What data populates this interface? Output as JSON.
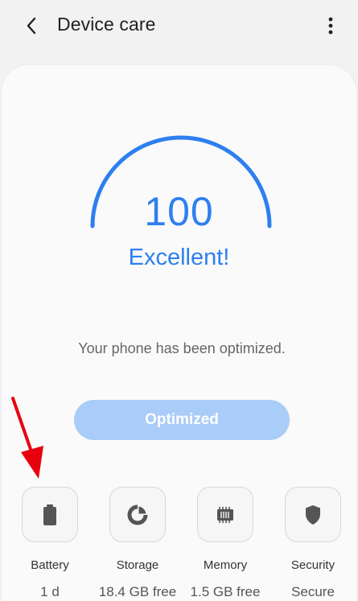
{
  "header": {
    "title": "Device care"
  },
  "gauge": {
    "score": "100",
    "status": "Excellent!",
    "fraction": 1.0,
    "color": "#2e7ff0"
  },
  "message": "Your phone has been optimized.",
  "button": {
    "label": "Optimized",
    "enabled": false
  },
  "tiles": [
    {
      "label": "Battery",
      "value": "1 d",
      "icon": "battery-icon"
    },
    {
      "label": "Storage",
      "value": "18.4 GB free",
      "icon": "storage-icon"
    },
    {
      "label": "Memory",
      "value": "1.5 GB free",
      "icon": "memory-icon"
    },
    {
      "label": "Security",
      "value": "Secure",
      "icon": "shield-icon"
    }
  ],
  "annotation": {
    "icon": "red-arrow-icon",
    "color": "#e8000f"
  }
}
